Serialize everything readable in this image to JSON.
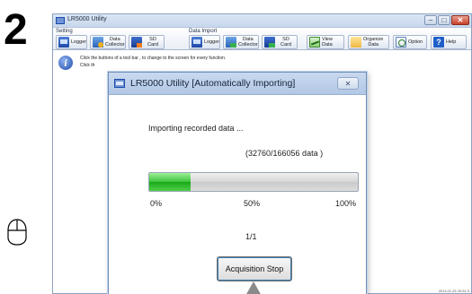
{
  "step_number": "2",
  "app": {
    "title": "LR5000 Utility",
    "window_controls": {
      "minimize": "–",
      "maximize": "□",
      "close": "✕"
    }
  },
  "ribbon": {
    "groups": {
      "setting": "Setting",
      "data_import": "Data Import"
    },
    "buttons": {
      "logger": "Logger",
      "data_collector": "Data\nCollector",
      "sd_card": "SD Card",
      "import_logger": "Logger",
      "import_data_collector": "Data\nCollector",
      "import_sd_card": "SD Card",
      "view_data": "View\nData",
      "organize_data": "Organize\nData",
      "option": "Option",
      "help": "Help"
    }
  },
  "content": {
    "hint_line1": "Click the buttons of a tool bar , to change to the screen for every function.",
    "hint_line2": "Click th",
    "status_time": "2011.01.23 20:51:3"
  },
  "dialog": {
    "title": "LR5000 Utility [Automatically Importing]",
    "close_glyph": "✕",
    "message": "Importing recorded data ...",
    "count_text": "(32760/166056 data )",
    "progress": {
      "current": 32760,
      "total": 166056
    },
    "tick_labels": [
      "0%",
      "50%",
      "100%"
    ],
    "pages": "1/1",
    "stop_button": "Acquisition Stop"
  },
  "colors": {
    "progress_green": "#3bc33a",
    "window_border": "#8da2c0",
    "dialog_title_bg": "#b1c8e6"
  }
}
